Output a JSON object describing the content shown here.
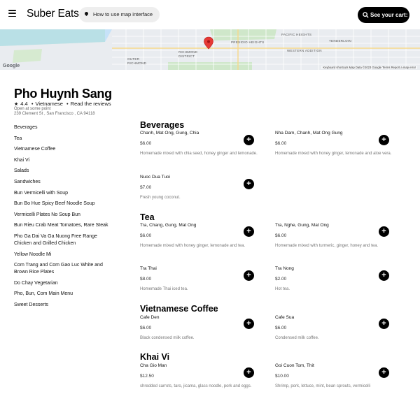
{
  "header": {
    "brand": "Suber Eats",
    "howto_label": "How to use map interface",
    "cart_label": "See your cart: 0"
  },
  "map": {
    "credits": "Keyboard shortcuts   Map Data ©2023 Google   Terms   Report a map error",
    "google_logo": "Google",
    "labels": {
      "richmond": "RICHMOND DISTRICT",
      "outer_richmond": "OUTER RICHMOND",
      "pacific_heights": "PACIFIC HEIGHTS",
      "tenderloin": "TENDERLOIN",
      "western_addition": "WESTERN ADDITION",
      "presidio": "PRESIDIO HEIGHTS"
    }
  },
  "restaurant": {
    "name": "Pho Huynh Sang",
    "rating": "4.4",
    "cuisine": "Vietnamese",
    "reviews_link": "Read the reviews",
    "open_text": "Open at some point",
    "address": "239 Clement St , San Francisco , CA 94118"
  },
  "nav": [
    "Beverages",
    "Tea",
    "Vietnamese Coffee",
    "Khai Vi",
    "Salads",
    "Sandwiches",
    "Bun Vermicelli with Soup",
    "Bun Bo Hue Spicy Beef Noodle Soup",
    "Vermicelli Plates No Soup Bun",
    "Bun Rieu Crab Meat Tomatoes, Rare Steak",
    "Pho Ga Dai Va Ga Nuong Free Range Chicken and Grilled Chicken",
    "Yellow Noodle Mi",
    "Com Trang and Com Gao Luc White and Brown Rice Plates",
    "Do Chay Vegetarian",
    "Pho, Bun, Com Main Menu",
    "Sweet Desserts"
  ],
  "sections": [
    {
      "title": "Beverages",
      "items": [
        {
          "name": "Chanh, Mat Ong, Gung, Chia",
          "price": "$6.00",
          "desc": "Homemade mixed with chia seed, honey ginger and lemonade."
        },
        {
          "name": "Nha Dam, Chanh, Mat Ong Gung",
          "price": "$6.00",
          "desc": "Homemade mixed with honey ginger, lemonade and aloe vera."
        },
        {
          "name": "Nuoc Dua Tuoi",
          "price": "$7.00",
          "desc": "Fresh young coconut."
        }
      ]
    },
    {
      "title": "Tea",
      "items": [
        {
          "name": "Tra, Chang, Gung, Mat Ong",
          "price": "$6.00",
          "desc": "Homemade mixed with honey ginger, lemonade and tea."
        },
        {
          "name": "Tra, Nghe, Gung, Mat Ong",
          "price": "$6.00",
          "desc": "Homemade mixed with turmeric, ginger, honey and tea."
        },
        {
          "name": "Tra Thai",
          "price": "$8.00",
          "desc": "Homemade Thai iced tea."
        },
        {
          "name": "Tra Nong",
          "price": "$2.00",
          "desc": "Hot tea."
        }
      ]
    },
    {
      "title": "Vietnamese Coffee",
      "items": [
        {
          "name": "Cafe Den",
          "price": "$6.00",
          "desc": "Black condensed milk coffee."
        },
        {
          "name": "Cafe Sua",
          "price": "$6.00",
          "desc": "Condensed milk coffee."
        }
      ]
    },
    {
      "title": "Khai Vi",
      "items": [
        {
          "name": "Cha Gio Man",
          "price": "$12.50",
          "desc": "shredded carrots, taro, jicama, glass noodle, pork and eggs."
        },
        {
          "name": "Goi Cuon Tom, Thit",
          "price": "$10.00",
          "desc": "Shrimp, pork, lettuce, mint, bean sprouts, vermicelli"
        }
      ]
    }
  ]
}
